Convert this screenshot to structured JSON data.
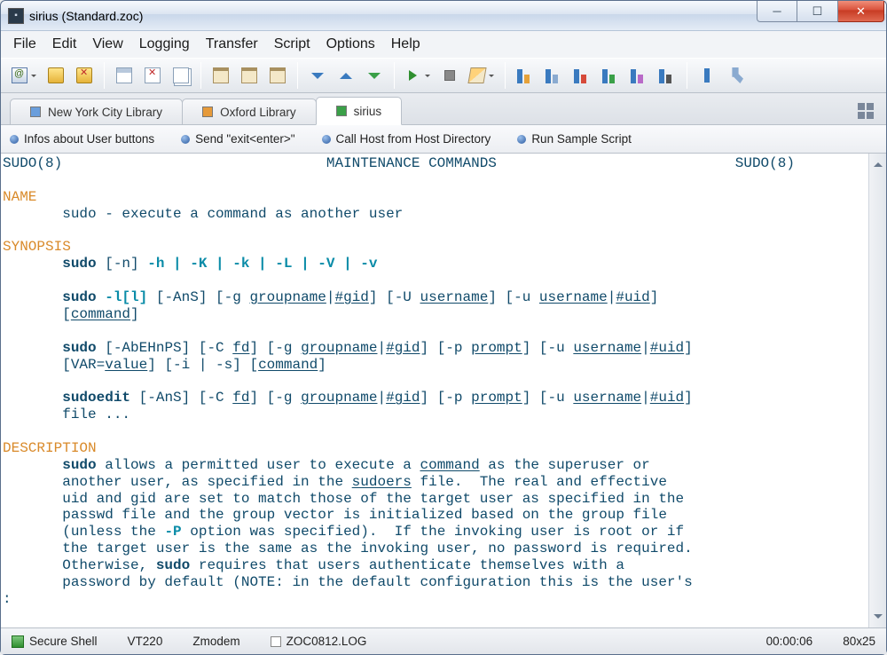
{
  "title": "sirius (Standard.zoc)",
  "menu": [
    "File",
    "Edit",
    "View",
    "Logging",
    "Transfer",
    "Script",
    "Options",
    "Help"
  ],
  "tabs": [
    {
      "label": "New York City Library",
      "color": "blue",
      "active": false
    },
    {
      "label": "Oxford Library",
      "color": "orange",
      "active": false
    },
    {
      "label": "sirius",
      "color": "green",
      "active": true
    }
  ],
  "userButtons": [
    "Infos about User buttons",
    "Send \"exit<enter>\"",
    "Call Host from Host Directory",
    "Run Sample Script"
  ],
  "terminalHeader": {
    "left": "SUDO(8)",
    "center": "MAINTENANCE COMMANDS",
    "right": "SUDO(8)"
  },
  "sections": {
    "name": "NAME",
    "nameBody": "       sudo - execute a command as another user",
    "synopsis": "SYNOPSIS",
    "description": "DESCRIPTION"
  },
  "syn1": {
    "cmd": "sudo",
    "opts": "-h | -K | -k | -L | -V | -v",
    "pre": " [-n] "
  },
  "syn2": {
    "cmd": "sudo",
    "l": " -l[l]",
    "ans": " [-AnS] [-g ",
    "group": "groupname",
    "gid": "#gid",
    "U": "] [-U ",
    "user": "username",
    "u2": "] [-u ",
    "uid": "#uid",
    "cmd2": "command"
  },
  "syn3": {
    "cmd": "sudo",
    "flags": " [-AbEHnPS] [-C ",
    "fd": "fd",
    "g": "] [-g ",
    "group": "groupname",
    "gid": "#gid",
    "p": "] [-p ",
    "prompt": "prompt",
    "u": "] [-u ",
    "user": "username",
    "uid": "#uid",
    "var": "       [VAR=",
    "value": "value",
    "is": "] [-i | -s] [",
    "cmd2": "command"
  },
  "syn4": {
    "cmd": "sudoedit",
    "ans": " [-AnS] [-C ",
    "fd": "fd",
    "g": "] [-g ",
    "group": "groupname",
    "gid": "#gid",
    "p": "] [-p ",
    "prompt": "prompt",
    "u": "] [-u ",
    "user": "username",
    "uid": "#uid",
    "tail": "       file ..."
  },
  "desc": {
    "l1a": "       ",
    "l1b": "sudo",
    "l1c": " allows a permitted user to execute a ",
    "l1d": "command",
    "l1e": " as the superuser or",
    "l2a": "       another user, as specified in the ",
    "l2b": "sudoers",
    "l2c": " file.  The real and effective",
    "l3": "       uid and gid are set to match those of the target user as specified in the",
    "l4": "       passwd file and the group vector is initialized based on the group file",
    "l5a": "       (unless the ",
    "l5b": "-P",
    "l5c": " option was specified).  If the invoking user is root or if",
    "l6": "       the target user is the same as the invoking user, no password is required.",
    "l7a": "       Otherwise, ",
    "l7b": "sudo",
    "l7c": " requires that users authenticate themselves with a",
    "l8": "       password by default (NOTE: in the default configuration this is the user's",
    "prompt": ":"
  },
  "status": {
    "conn": "Secure Shell",
    "term": "VT220",
    "xfer": "Zmodem",
    "log": "ZOC0812.LOG",
    "time": "00:00:06",
    "size": "80x25"
  }
}
